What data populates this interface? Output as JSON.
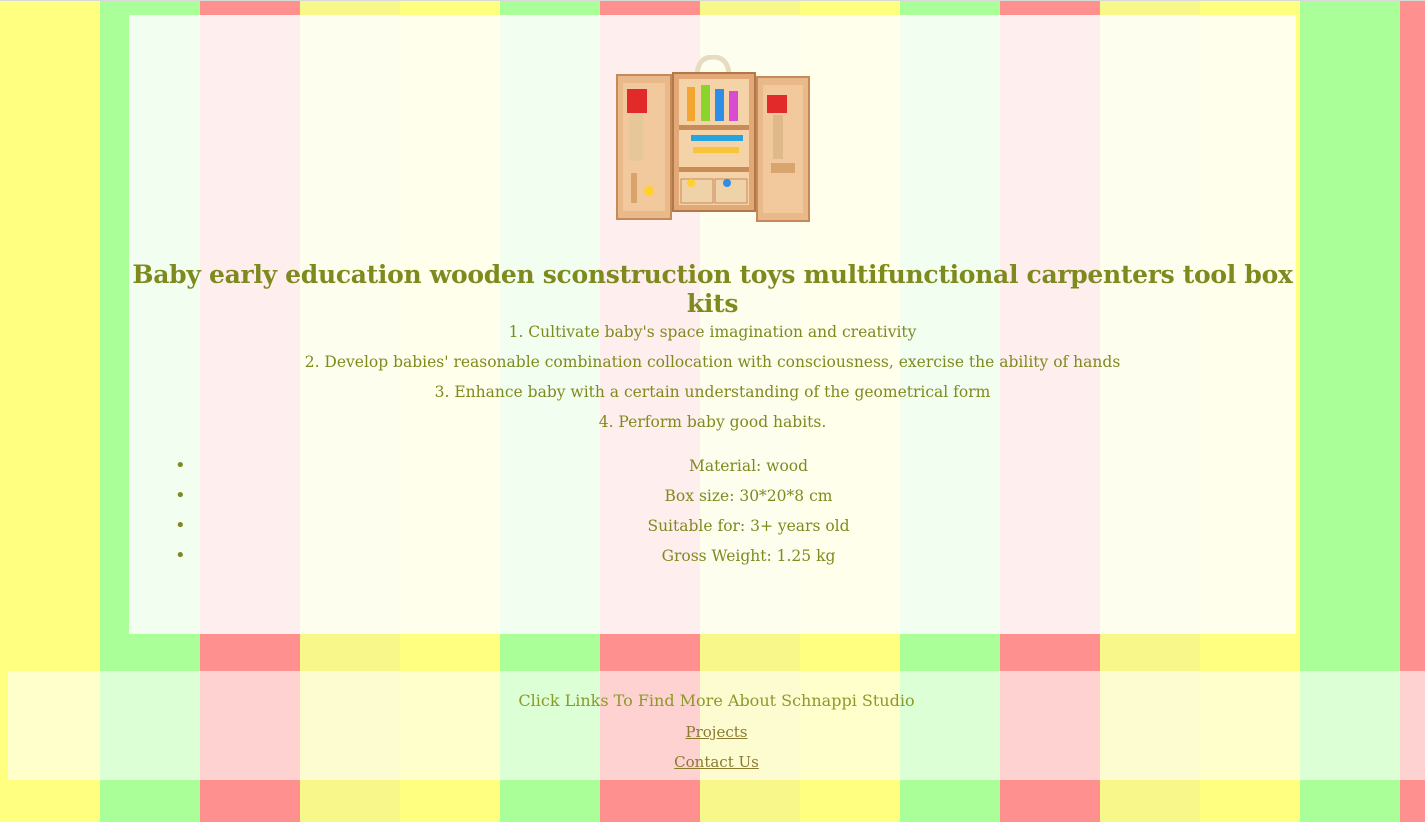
{
  "product": {
    "image_alt": "wooden carpenters tool box toy",
    "title": "Baby early education wooden sconstruction toys multifunctional carpenters tool box kits",
    "features": [
      "1. Cultivate baby's space imagination and creativity",
      "2. Develop babies' reasonable combination collocation with consciousness, exercise the ability of hands",
      "3. Enhance baby with a certain understanding of the geometrical form",
      "4. Perform baby good habits."
    ],
    "specs": [
      "Material: wood",
      "Box size: 30*20*8 cm",
      "Suitable for: 3+ years old",
      "Gross Weight: 1.25 kg"
    ]
  },
  "footer": {
    "text": "Click Links To Find More About Schnappi Studio",
    "links": [
      "Projects",
      "Contact Us"
    ]
  },
  "colors": {
    "text": "#7f8a1e",
    "stripes": [
      "#ffff80",
      "#aaff99",
      "#ff9090",
      "#f7f78a"
    ]
  }
}
